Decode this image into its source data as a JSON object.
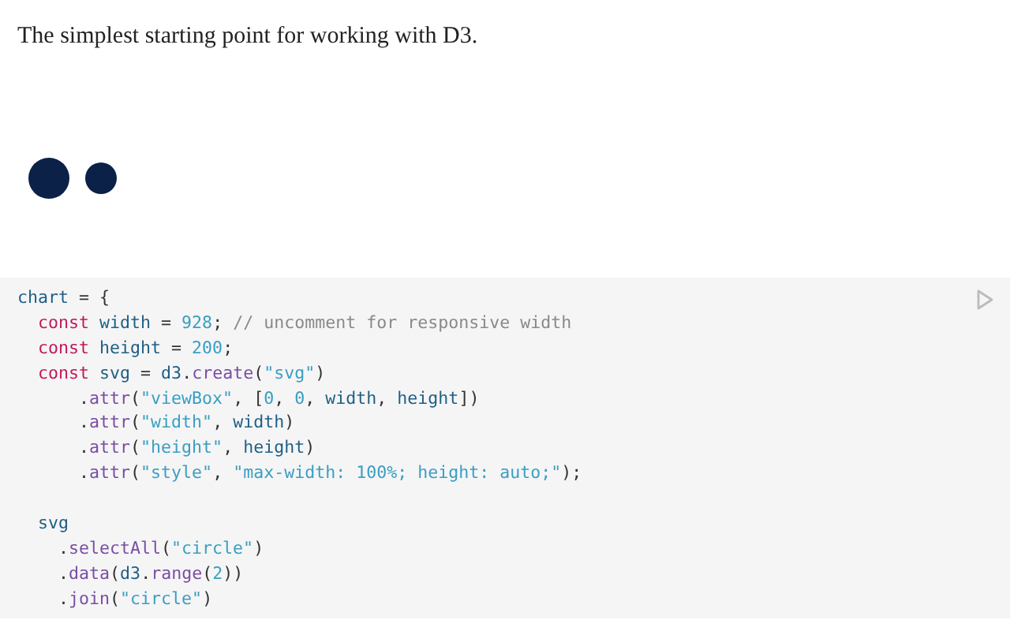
{
  "intro": "The simplest starting point for working with D3.",
  "code": {
    "lines": [
      {
        "kind": "code",
        "tokens": [
          {
            "kind": "variable",
            "text": "chart"
          },
          {
            "kind": "plain",
            "text": " = {"
          }
        ]
      },
      {
        "kind": "code",
        "tokens": [
          {
            "kind": "keyword",
            "text": "  const"
          },
          {
            "kind": "variable",
            "text": " width"
          },
          {
            "kind": "plain",
            "text": " = "
          },
          {
            "kind": "number",
            "text": "928"
          },
          {
            "kind": "plain",
            "text": "; "
          },
          {
            "kind": "comment",
            "text": "// uncomment for responsive width"
          }
        ]
      },
      {
        "kind": "code",
        "tokens": [
          {
            "kind": "keyword",
            "text": "  const"
          },
          {
            "kind": "variable",
            "text": " height"
          },
          {
            "kind": "plain",
            "text": " = "
          },
          {
            "kind": "number",
            "text": "200"
          },
          {
            "kind": "plain",
            "text": ";"
          }
        ]
      },
      {
        "kind": "code",
        "tokens": [
          {
            "kind": "keyword",
            "text": "  const"
          },
          {
            "kind": "variable",
            "text": " svg"
          },
          {
            "kind": "plain",
            "text": " = "
          },
          {
            "kind": "variable",
            "text": "d3"
          },
          {
            "kind": "plain",
            "text": "."
          },
          {
            "kind": "method",
            "text": "create"
          },
          {
            "kind": "plain",
            "text": "("
          },
          {
            "kind": "string",
            "text": "\"svg\""
          },
          {
            "kind": "plain",
            "text": ")"
          }
        ]
      },
      {
        "kind": "code",
        "tokens": [
          {
            "kind": "plain",
            "text": "      ."
          },
          {
            "kind": "method",
            "text": "attr"
          },
          {
            "kind": "plain",
            "text": "("
          },
          {
            "kind": "string",
            "text": "\"viewBox\""
          },
          {
            "kind": "plain",
            "text": ", ["
          },
          {
            "kind": "number",
            "text": "0"
          },
          {
            "kind": "plain",
            "text": ", "
          },
          {
            "kind": "number",
            "text": "0"
          },
          {
            "kind": "plain",
            "text": ", "
          },
          {
            "kind": "variable",
            "text": "width"
          },
          {
            "kind": "plain",
            "text": ", "
          },
          {
            "kind": "variable",
            "text": "height"
          },
          {
            "kind": "plain",
            "text": "])"
          }
        ]
      },
      {
        "kind": "code",
        "tokens": [
          {
            "kind": "plain",
            "text": "      ."
          },
          {
            "kind": "method",
            "text": "attr"
          },
          {
            "kind": "plain",
            "text": "("
          },
          {
            "kind": "string",
            "text": "\"width\""
          },
          {
            "kind": "plain",
            "text": ", "
          },
          {
            "kind": "variable",
            "text": "width"
          },
          {
            "kind": "plain",
            "text": ")"
          }
        ]
      },
      {
        "kind": "code",
        "tokens": [
          {
            "kind": "plain",
            "text": "      ."
          },
          {
            "kind": "method",
            "text": "attr"
          },
          {
            "kind": "plain",
            "text": "("
          },
          {
            "kind": "string",
            "text": "\"height\""
          },
          {
            "kind": "plain",
            "text": ", "
          },
          {
            "kind": "variable",
            "text": "height"
          },
          {
            "kind": "plain",
            "text": ")"
          }
        ]
      },
      {
        "kind": "code",
        "tokens": [
          {
            "kind": "plain",
            "text": "      ."
          },
          {
            "kind": "method",
            "text": "attr"
          },
          {
            "kind": "plain",
            "text": "("
          },
          {
            "kind": "string",
            "text": "\"style\""
          },
          {
            "kind": "plain",
            "text": ", "
          },
          {
            "kind": "string",
            "text": "\"max-width: 100%; height: auto;\""
          },
          {
            "kind": "plain",
            "text": ");"
          }
        ]
      },
      {
        "kind": "blank"
      },
      {
        "kind": "code",
        "tokens": [
          {
            "kind": "variable",
            "text": "  svg"
          }
        ]
      },
      {
        "kind": "code",
        "tokens": [
          {
            "kind": "plain",
            "text": "    ."
          },
          {
            "kind": "method",
            "text": "selectAll"
          },
          {
            "kind": "plain",
            "text": "("
          },
          {
            "kind": "string",
            "text": "\"circle\""
          },
          {
            "kind": "plain",
            "text": ")"
          }
        ]
      },
      {
        "kind": "code",
        "tokens": [
          {
            "kind": "plain",
            "text": "    ."
          },
          {
            "kind": "method",
            "text": "data"
          },
          {
            "kind": "plain",
            "text": "("
          },
          {
            "kind": "variable",
            "text": "d3"
          },
          {
            "kind": "plain",
            "text": "."
          },
          {
            "kind": "method",
            "text": "range"
          },
          {
            "kind": "plain",
            "text": "("
          },
          {
            "kind": "number",
            "text": "2"
          },
          {
            "kind": "plain",
            "text": "))"
          }
        ]
      },
      {
        "kind": "code",
        "tokens": [
          {
            "kind": "plain",
            "text": "    ."
          },
          {
            "kind": "method",
            "text": "join"
          },
          {
            "kind": "plain",
            "text": "("
          },
          {
            "kind": "string",
            "text": "\"circle\""
          },
          {
            "kind": "plain",
            "text": ")"
          }
        ]
      }
    ]
  }
}
